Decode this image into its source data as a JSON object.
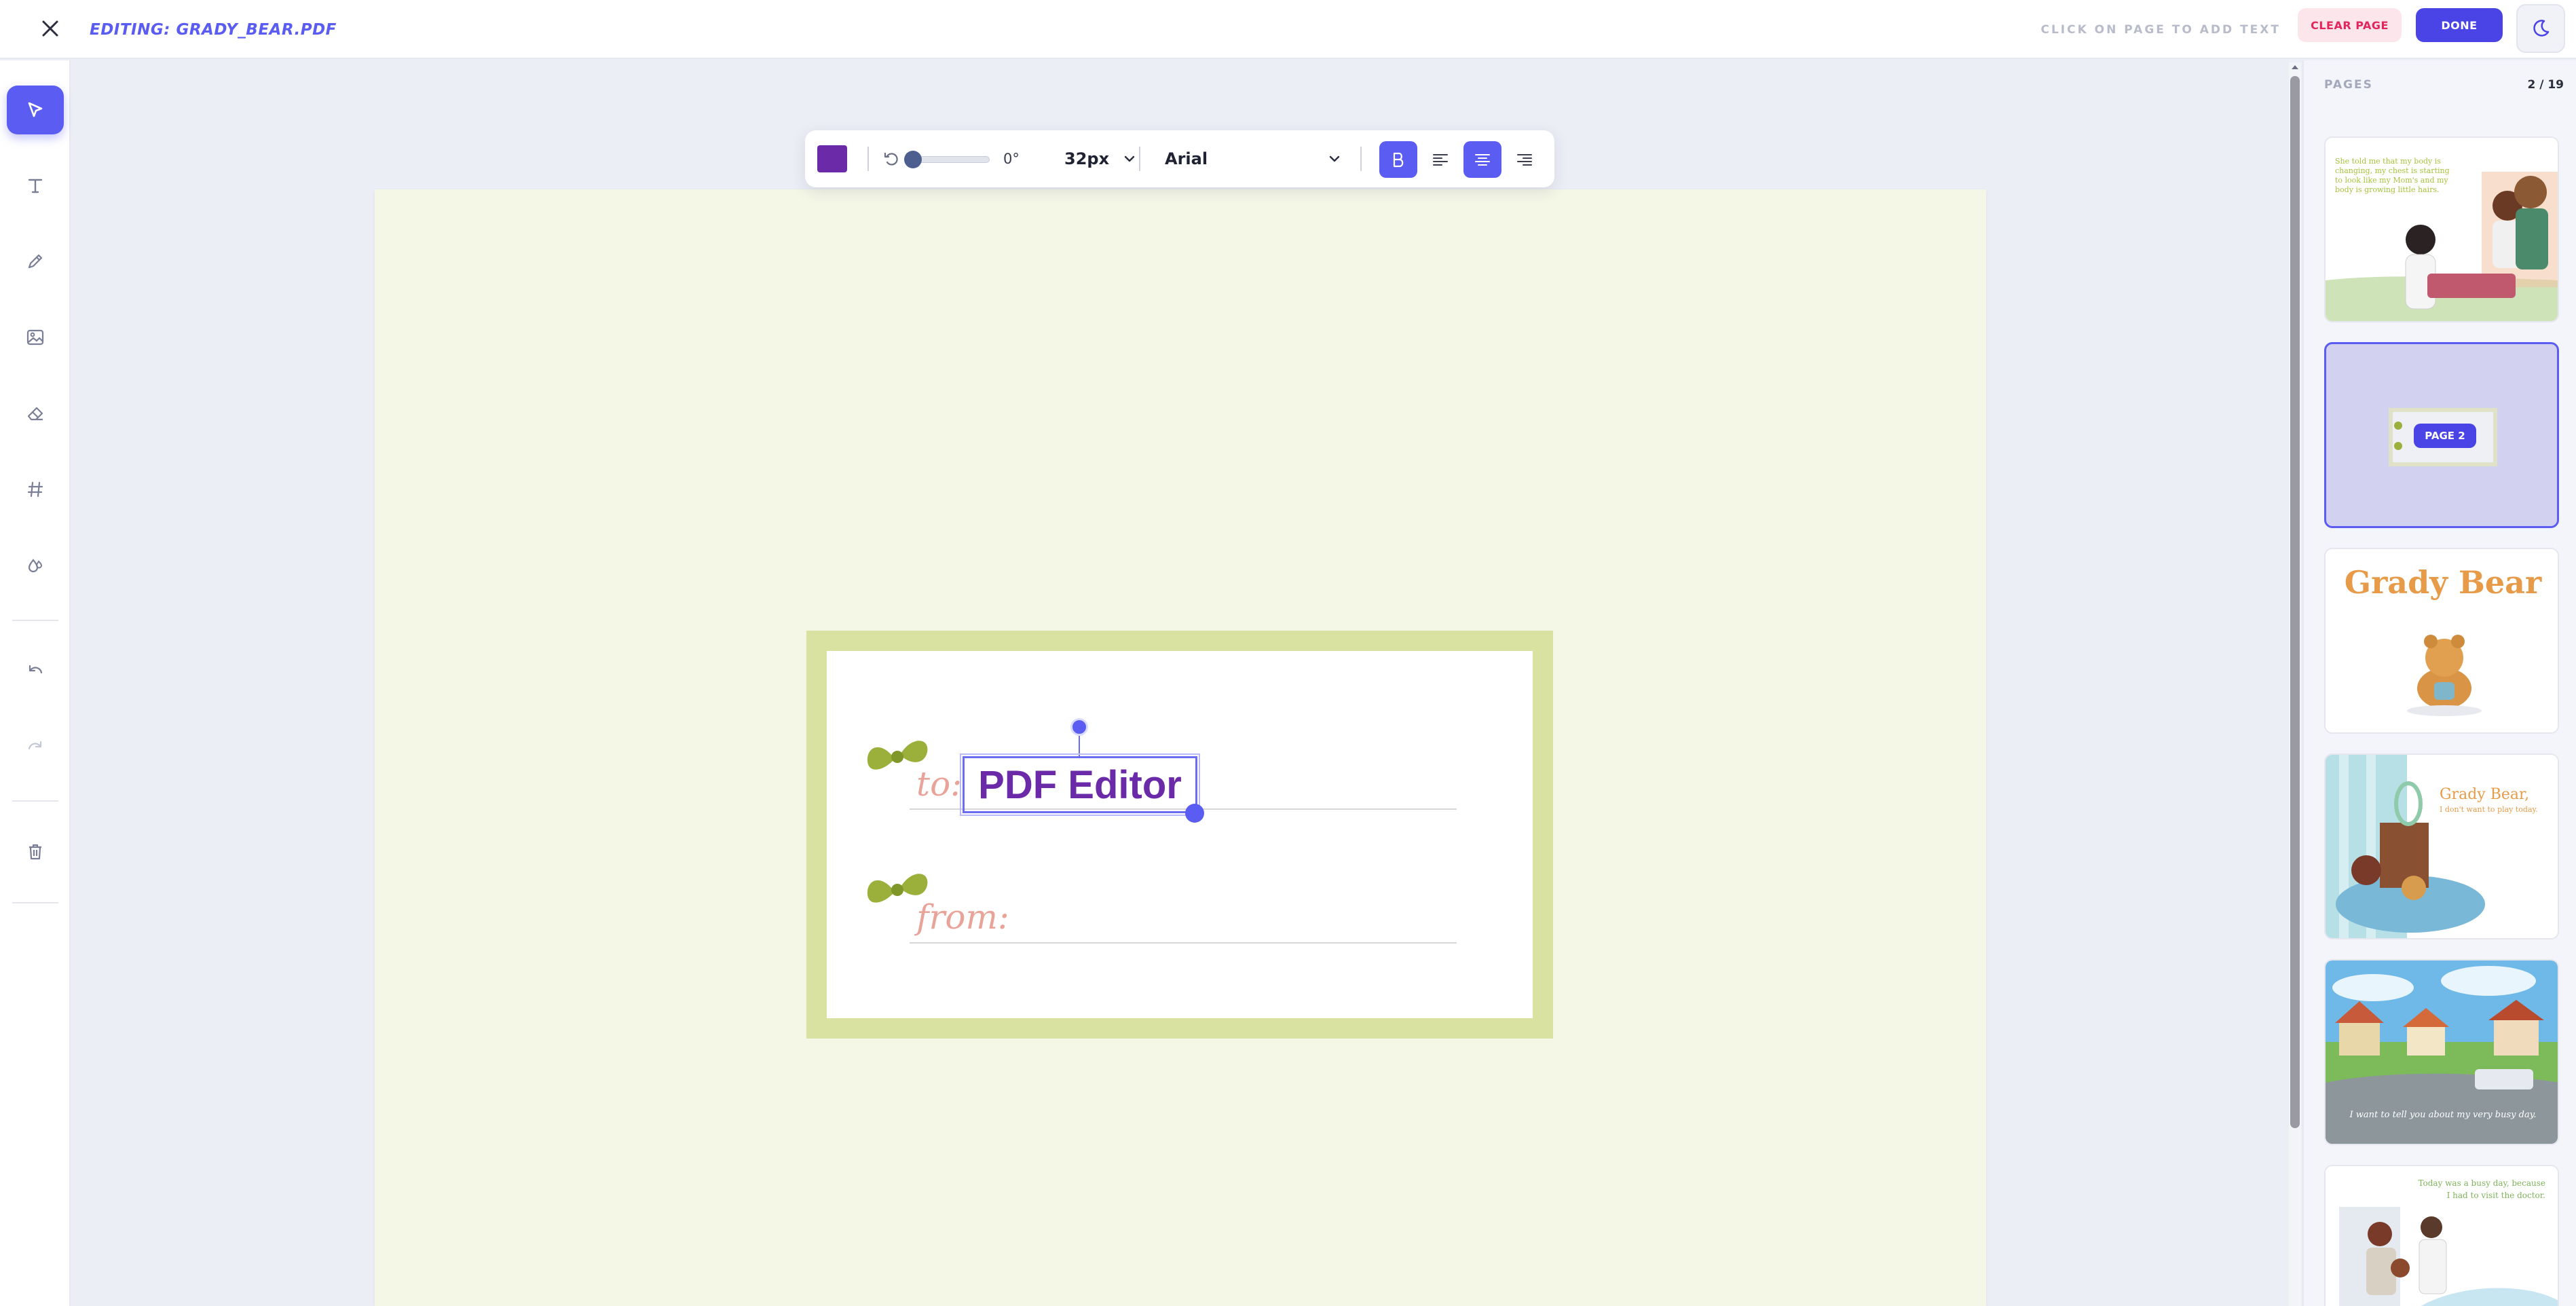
{
  "header": {
    "title": "EDITING: GRADY_BEAR.PDF",
    "hint": "CLICK ON PAGE TO ADD TEXT",
    "clear_label": "CLEAR PAGE",
    "done_label": "DONE"
  },
  "tools": [
    {
      "icon": "cursor-icon",
      "active": true
    },
    {
      "icon": "text-icon"
    },
    {
      "icon": "pencil-icon"
    },
    {
      "icon": "image-icon"
    },
    {
      "icon": "eraser-icon"
    },
    {
      "icon": "hash-icon"
    },
    {
      "icon": "color-drop-icon"
    },
    {
      "icon": "undo-icon"
    },
    {
      "icon": "redo-icon"
    },
    {
      "icon": "trash-icon"
    }
  ],
  "format_toolbar": {
    "color": "#6b2aa8",
    "rotation": "0°",
    "rotation_level": 0,
    "font_size": "32px",
    "font_family": "Arial",
    "bold": true,
    "alignment": "center"
  },
  "canvas": {
    "tag_to_label": "to:",
    "tag_from_label": "from:",
    "text_box_value": "PDF Editor"
  },
  "pages": {
    "title": "PAGES",
    "count": "2 / 19",
    "thumbnails": [
      {
        "text": "She told me that my body is changing, my chest is starting to look like my Mom's and my body is growing little hairs."
      },
      {
        "badge": "PAGE 2",
        "selected": true
      },
      {
        "text": "Grady Bear"
      },
      {
        "text": "Grady Bear,",
        "sub": "I don't want to play today."
      },
      {
        "text": "I want to tell you about my very busy day."
      },
      {
        "text": "Today was a busy day, because",
        "sub": "I had to visit the doctor."
      }
    ]
  },
  "colors": {
    "accent": "#5a5cf2",
    "done": "#4a44e6",
    "clear_bg": "#fde5ec",
    "clear_text": "#e3255c",
    "text_color": "#6b2aa8"
  }
}
